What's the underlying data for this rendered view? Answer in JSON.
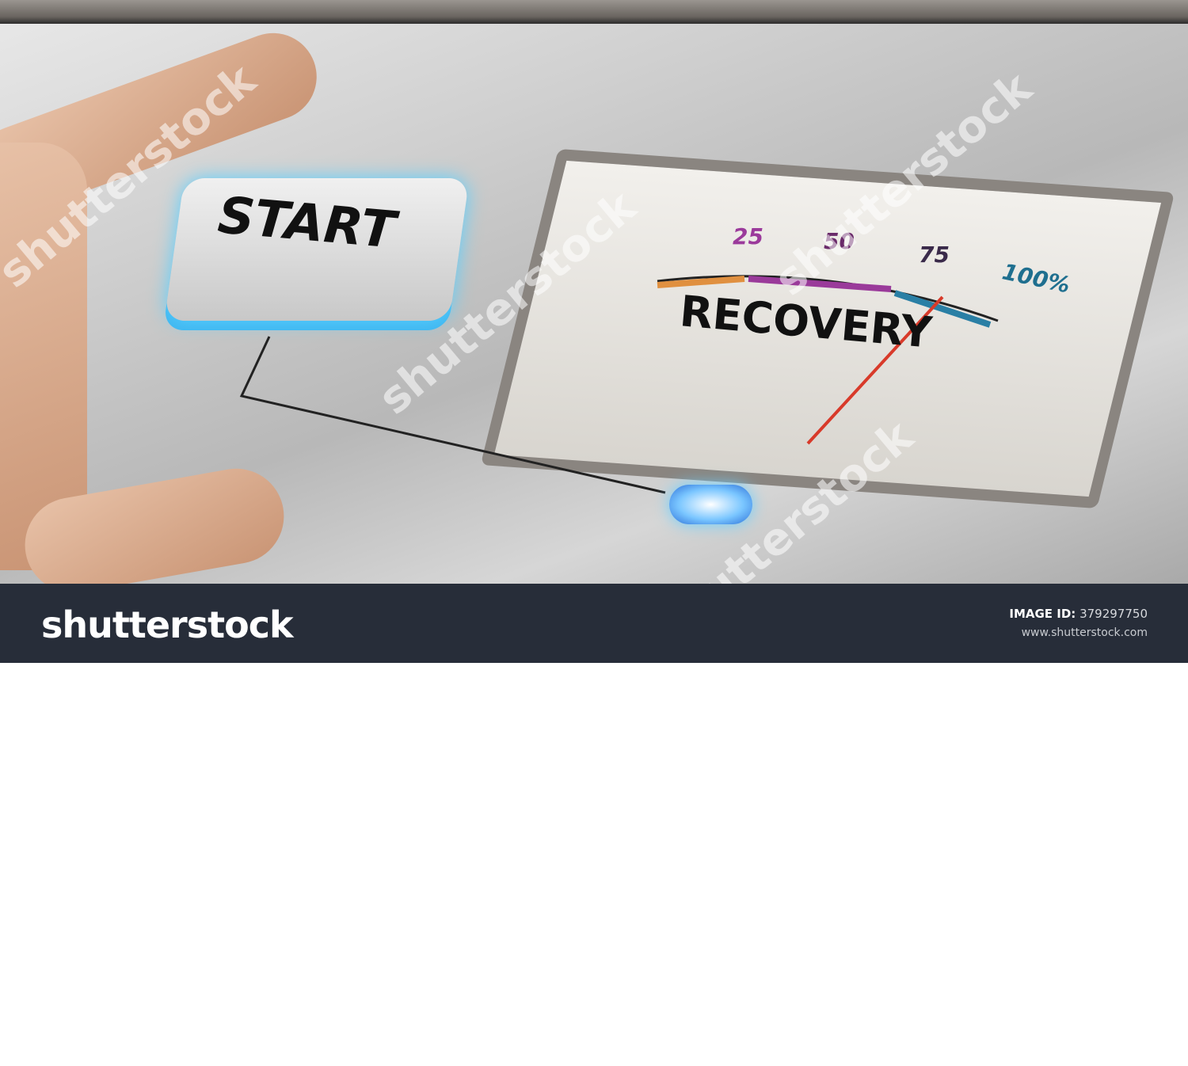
{
  "photo": {
    "button_label": "START",
    "gauge_label": "RECOVERY",
    "gauge_ticks": [
      "25",
      "50",
      "75",
      "100%"
    ],
    "watermark": "shutterstock"
  },
  "footer": {
    "logo": "shutterstock",
    "image_id_label": "IMAGE ID:",
    "image_id": "379297750",
    "website": "www.shutterstock.com"
  }
}
